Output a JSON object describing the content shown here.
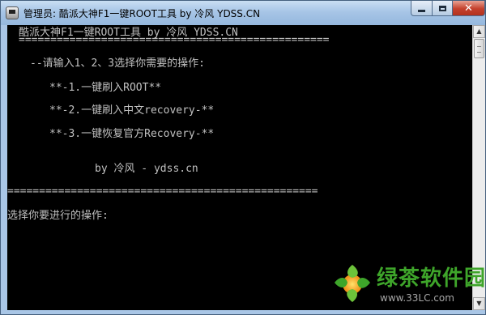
{
  "window": {
    "title": "管理员:  酷派大神F1一键ROOT工具 by 冷风 YDSS.CN",
    "icon": "cmd-icon"
  },
  "console_lines": [
    "酷派大神F1一键ROOT工具 by 冷风 YDSS.CN",
    "=================================================",
    "--请输入1、2、3选择你需要的操作:",
    "**-1.一键刷入ROOT**",
    "**-2.一键刷入中文recovery-**",
    "**-3.一键恢复官方Recovery-**",
    "by 冷风 - ydss.cn",
    "=================================================",
    "选择你要进行的操作:"
  ],
  "watermark": {
    "name": "绿茶软件园",
    "url": "www.33LC.com"
  },
  "colors": {
    "console_bg": "#000000",
    "console_text": "#c0c0c0",
    "watermark_green": "#3ea52a"
  }
}
